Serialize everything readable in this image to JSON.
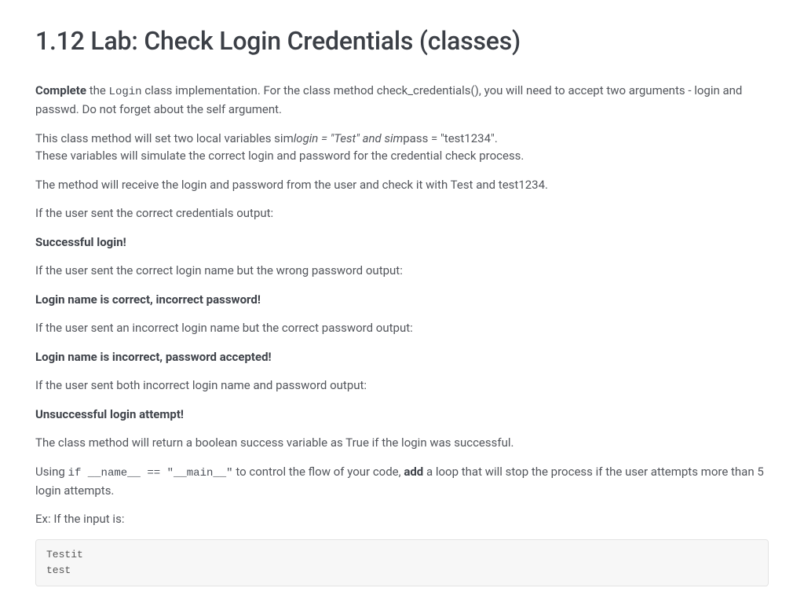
{
  "title": "1.12 Lab: Check Login Credentials (classes)",
  "p1": {
    "complete": "Complete",
    "the": " the ",
    "login_code": "Login",
    "rest": " class implementation. For the class method check_credentials(), you will need to accept two arguments - login and passwd. Do not forget about the self argument."
  },
  "p2": {
    "a": "This class method will set two local variables sim",
    "italic": "login = \"Test\" and sim",
    "b": "pass = \"test1234\".",
    "line2": "These variables will simulate the correct login and password for the credential check process."
  },
  "p3": "The method will receive the login and password from the user and check it with Test and test1234.",
  "p4": "If the user sent the correct credentials output:",
  "out1": "Successful login!",
  "p5": "If the user sent the correct login name but the wrong password output:",
  "out2": "Login name is correct, incorrect password!",
  "p6": "If the user sent an incorrect login name but the correct password output:",
  "out3": "Login name is incorrect, password accepted!",
  "p7": "If the user sent both incorrect login name and password output:",
  "out4": "Unsuccessful login attempt!",
  "p8": "The class method will return a boolean success variable as True if the login was successful.",
  "p9": {
    "using": "Using ",
    "code": "if __name__ == \"__main__\"",
    "mid": " to control the flow of your code, ",
    "add": "add",
    "rest": " a loop that will stop the process if the user attempts more than 5 login attempts."
  },
  "p10": "Ex: If the input is:",
  "codeblock": "Testit\ntest"
}
